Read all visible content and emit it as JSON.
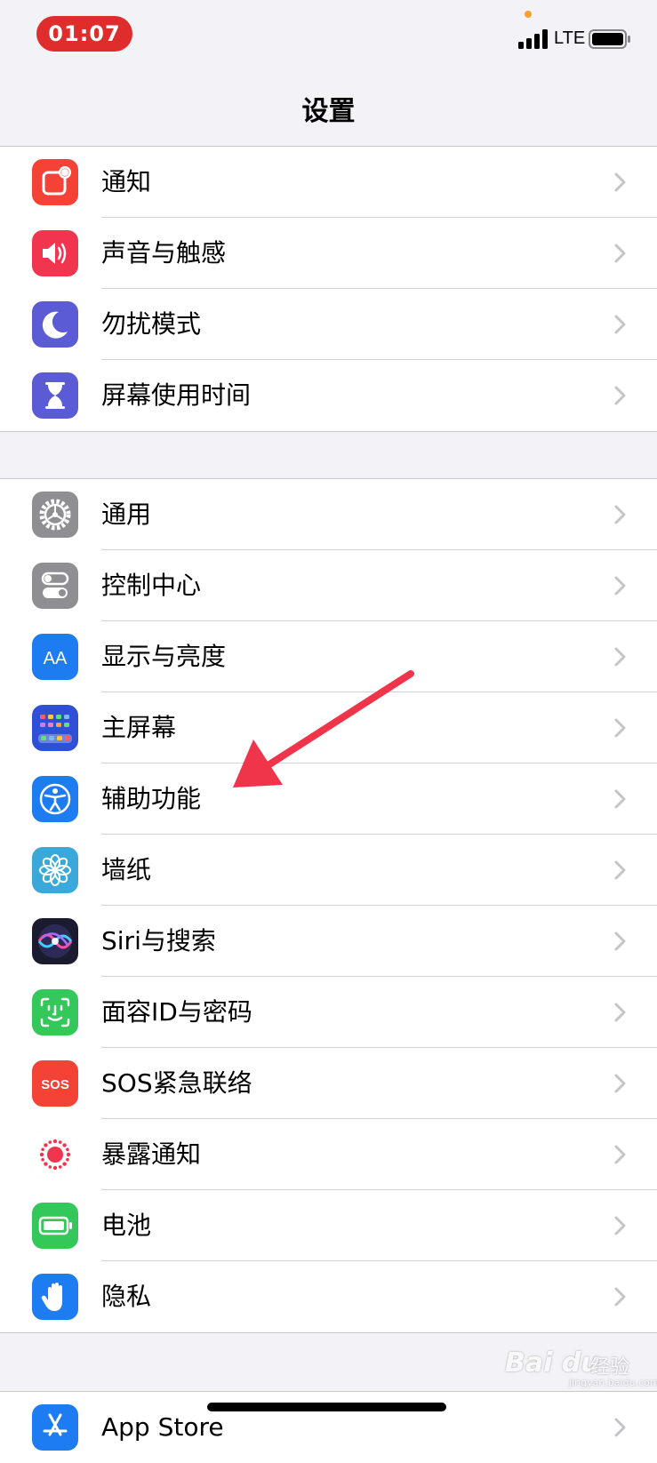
{
  "status_bar": {
    "time": "01:07",
    "network": "LTE",
    "colors": {
      "time_pill": "#de2d2b",
      "privacy_dot": "#f8a12f"
    }
  },
  "nav": {
    "title": "设置"
  },
  "groups": [
    {
      "items": [
        {
          "label": "通知",
          "icon": "notifications-icon",
          "color": "#f44336"
        },
        {
          "label": "声音与触感",
          "icon": "sounds-icon",
          "color": "#f2354f"
        },
        {
          "label": "勿扰模式",
          "icon": "do-not-disturb-moon-icon",
          "color": "#5b5bd6"
        },
        {
          "label": "屏幕使用时间",
          "icon": "screen-time-hourglass-icon",
          "color": "#5b5bd6"
        }
      ]
    },
    {
      "items": [
        {
          "label": "通用",
          "icon": "general-gear-icon",
          "color": "#8e8e93"
        },
        {
          "label": "控制中心",
          "icon": "control-center-toggles-icon",
          "color": "#8e8e93"
        },
        {
          "label": "显示与亮度",
          "icon": "display-brightness-aa-icon",
          "icon_text": "AA",
          "color": "#1e7cf2"
        },
        {
          "label": "主屏幕",
          "icon": "home-screen-grid-icon",
          "color": "#2f4fd6"
        },
        {
          "label": "辅助功能",
          "icon": "accessibility-person-icon",
          "color": "#1e7cf2"
        },
        {
          "label": "墙纸",
          "icon": "wallpaper-flower-icon",
          "color": "#3aa9d9"
        },
        {
          "label": "Siri与搜索",
          "icon": "siri-icon",
          "color": "#1b1b2f"
        },
        {
          "label": "面容ID与密码",
          "icon": "face-id-icon",
          "color": "#34c759"
        },
        {
          "label": "SOS紧急联络",
          "icon": "sos-icon",
          "icon_text": "SOS",
          "color": "#f44336"
        },
        {
          "label": "暴露通知",
          "icon": "exposure-notification-icon",
          "color": "#ffffff"
        },
        {
          "label": "电池",
          "icon": "battery-icon",
          "color": "#34c759"
        },
        {
          "label": "隐私",
          "icon": "privacy-hand-icon",
          "color": "#1e7cf2"
        }
      ]
    },
    {
      "items": [
        {
          "label": "App Store",
          "icon": "app-store-icon",
          "color": "#1e7cf2"
        }
      ]
    }
  ],
  "annotation": {
    "arrow_color": "#f0354a",
    "points_to": "辅助功能"
  },
  "watermark": {
    "logo": "Bai du",
    "brand": "经验",
    "url": "jingyan.baidu.com"
  }
}
